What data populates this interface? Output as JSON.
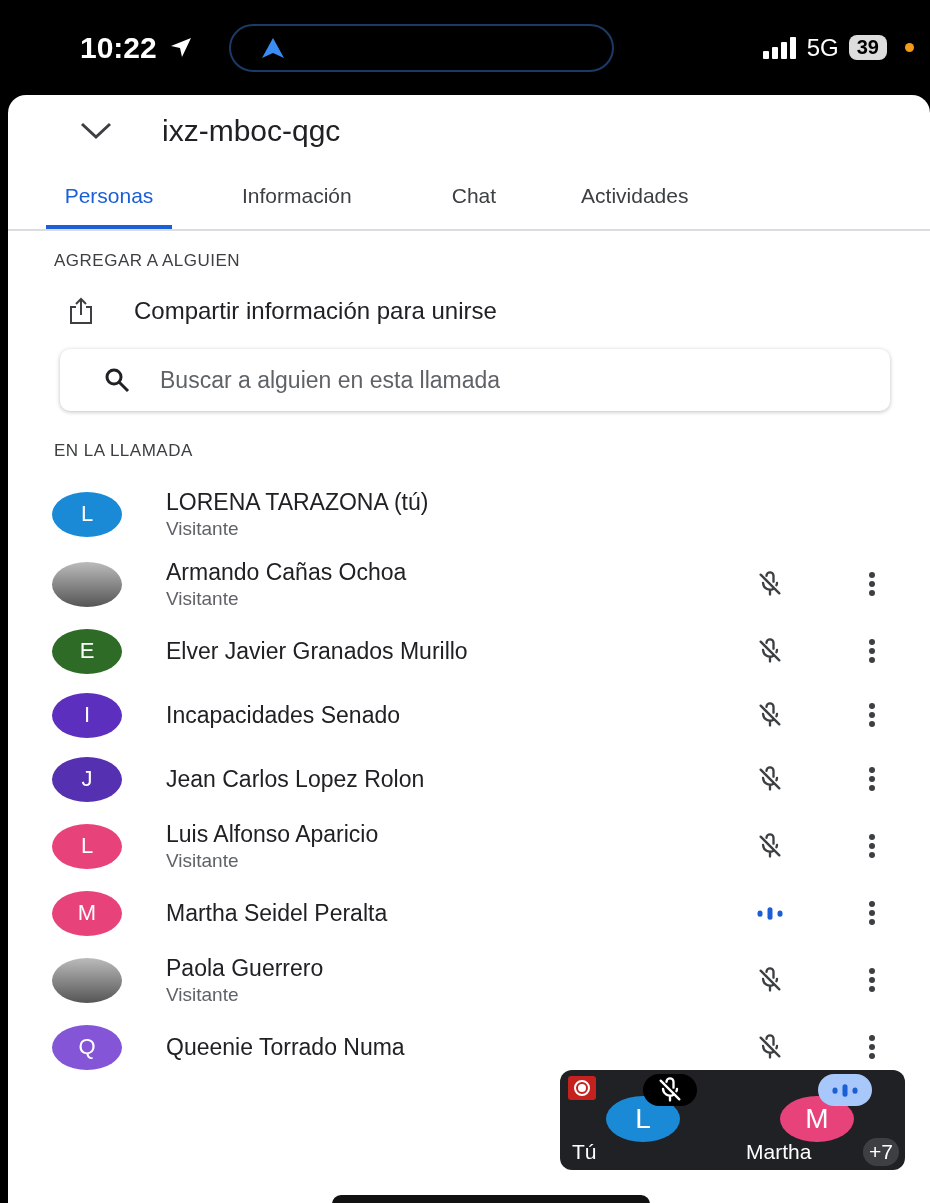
{
  "status_bar": {
    "time": "10:22",
    "network": "5G",
    "battery": "39"
  },
  "header": {
    "title": "ixz-mboc-qgc"
  },
  "tabs": [
    {
      "label": "Personas",
      "selected": true
    },
    {
      "label": "Información",
      "selected": false
    },
    {
      "label": "Chat",
      "selected": false
    },
    {
      "label": "Actividades",
      "selected": false
    }
  ],
  "add_section": {
    "heading": "AGREGAR A ALGUIEN",
    "share_label": "Compartir información para unirse"
  },
  "search": {
    "placeholder": "Buscar a alguien en esta llamada"
  },
  "call_section": {
    "heading": "EN LA LLAMADA"
  },
  "participants": [
    {
      "name": "LORENA TARAZONA (tú)",
      "role": "Visitante",
      "avatar": {
        "kind": "letter",
        "letter": "L",
        "color": "#1a8ad6"
      },
      "muted": false,
      "speaking": false,
      "has_menu": false
    },
    {
      "name": "Armando Cañas Ochoa",
      "role": "Visitante",
      "avatar": {
        "kind": "photo"
      },
      "muted": true,
      "speaking": false,
      "has_menu": true
    },
    {
      "name": "Elver Javier Granados Murillo",
      "avatar": {
        "kind": "letter",
        "letter": "E",
        "color": "#2e6b26"
      },
      "muted": true,
      "speaking": false,
      "has_menu": true
    },
    {
      "name": "Incapacidades Senado",
      "avatar": {
        "kind": "letter",
        "letter": "I",
        "color": "#5c2fbf"
      },
      "muted": true,
      "speaking": false,
      "has_menu": true
    },
    {
      "name": "Jean Carlos Lopez Rolon",
      "avatar": {
        "kind": "letter",
        "letter": "J",
        "color": "#5530b0"
      },
      "muted": true,
      "speaking": false,
      "has_menu": true
    },
    {
      "name": "Luis Alfonso Aparicio",
      "role": "Visitante",
      "avatar": {
        "kind": "letter",
        "letter": "L",
        "color": "#e8427a"
      },
      "muted": true,
      "speaking": false,
      "has_menu": true
    },
    {
      "name": "Martha Seidel Peralta",
      "avatar": {
        "kind": "letter",
        "letter": "M",
        "color": "#e8427a"
      },
      "muted": false,
      "speaking": true,
      "has_menu": true
    },
    {
      "name": "Paola Guerrero",
      "role": "Visitante",
      "avatar": {
        "kind": "photo"
      },
      "muted": true,
      "speaking": false,
      "has_menu": true
    },
    {
      "name": "Queenie Torrado Numa",
      "avatar": {
        "kind": "letter",
        "letter": "Q",
        "color": "#8455d6"
      },
      "muted": true,
      "speaking": false,
      "has_menu": true
    }
  ],
  "mini_view": {
    "recording": true,
    "tiles": [
      {
        "label": "Tú",
        "letter": "L",
        "color": "#1a8ad6",
        "muted": true,
        "speaking": false
      },
      {
        "label": "Martha",
        "letter": "M",
        "color": "#e8427a",
        "muted": false,
        "speaking": true
      }
    ],
    "more_count": "+7"
  }
}
